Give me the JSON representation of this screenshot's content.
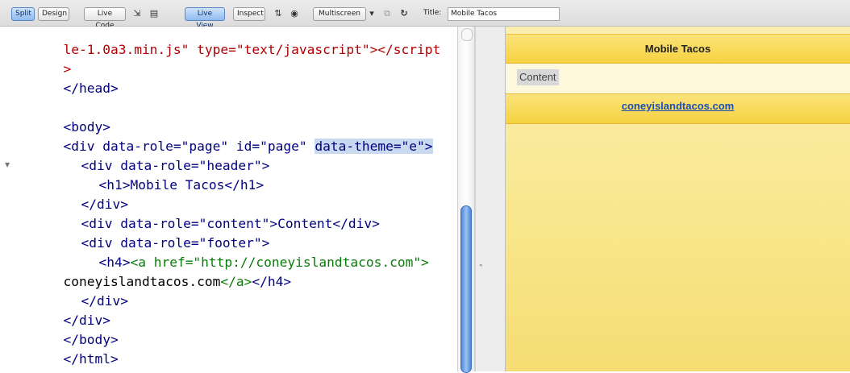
{
  "toolbar": {
    "split_label": "Split",
    "design_label": "Design",
    "live_code_label": "Live Code",
    "live_view_label": "Live View",
    "inspect_label": "Inspect",
    "multiscreen_label": "Multiscreen",
    "title_label": "Title:",
    "title_value": "Mobile Tacos",
    "icons": [
      "inspect-mode-icon",
      "check-browser-icon",
      "navigation-options-icon",
      "preview-globe-icon",
      "dropdown-arrow-icon",
      "file-management-icon",
      "refresh-icon"
    ]
  },
  "code": {
    "line1": "le-1.0a3.min.js\" type=\"text/javascript\"></script",
    "line2": ">",
    "line3": "</head>",
    "line5": "<body>",
    "line6_a": "<div data-role=\"page\" id=\"page\" ",
    "line6_b": "data-theme=\"e\">",
    "line7": "<div data-role=\"header\">",
    "line8": "<h1>Mobile Tacos</h1>",
    "line9": "</div>",
    "line10": "<div data-role=\"content\">Content</div>",
    "line11": "<div data-role=\"footer\">",
    "line12_a": "<h4>",
    "line12_b": "<a href=\"http://coneyislandtacos.com\">",
    "line13_a": "coneyislandtacos.com",
    "line13_b": "</a>",
    "line13_c": "</h4>",
    "line14": "</div>",
    "line15": "</div>",
    "line16": "</body>",
    "line17": "</html>"
  },
  "live_view": {
    "header_title": "Mobile Tacos",
    "content_text": "Content",
    "footer_link": "coneyislandtacos.com"
  },
  "colors": {
    "tag": "#000080",
    "attribute_value": "#0000d0",
    "anchor_tag": "#0a7a0a",
    "script_tag_end": "#b00000",
    "selection": "#c9d9f0",
    "jqm_theme_e": "#f6d240",
    "link": "#1a4fb8"
  }
}
